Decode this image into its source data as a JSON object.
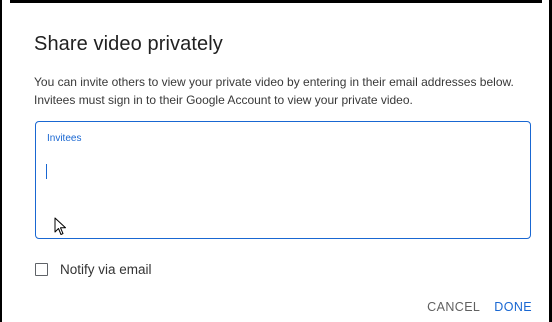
{
  "dialog": {
    "title": "Share video privately",
    "description_line1": "You can invite others to view your private video by entering in their email addresses below.",
    "description_line2": "Invitees must sign in to their Google Account to view your private video.",
    "invitees": {
      "label": "Invitees",
      "value": ""
    },
    "notify": {
      "label": "Notify via email",
      "checked": false
    },
    "actions": {
      "cancel_label": "CANCEL",
      "done_label": "DONE"
    }
  },
  "colors": {
    "accent": "#1967d2",
    "title_text": "#212121",
    "body_text": "#383838",
    "cancel_text": "#606060"
  },
  "icons": {
    "pointer": "mouse-pointer-icon"
  }
}
